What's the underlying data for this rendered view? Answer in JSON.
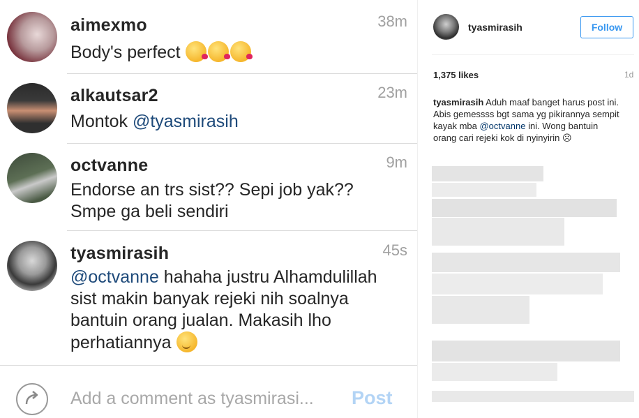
{
  "comments": [
    {
      "username": "aimexmo",
      "time": "38m",
      "text": "Body's perfect"
    },
    {
      "username": "alkautsar2",
      "time": "23m",
      "text_prefix": "Montok ",
      "mention": "@tyasmirasih"
    },
    {
      "username": "octvanne",
      "time": "9m",
      "line1": "Endorse an trs sist?? Sepi job yak??",
      "line2": "Smpe ga beli sendiri"
    },
    {
      "username": "tyasmirasih",
      "time": "45s",
      "mention": "@octvanne",
      "line1_rest": " hahaha justru Alhamdulillah",
      "line2": "sist makin banyak rejeki nih soalnya",
      "line3": "bantuin orang jualan. Makasih lho",
      "line4": "perhatiannya"
    }
  ],
  "composer": {
    "placeholder": "Add a comment as tyasmirasi...",
    "post_label": "Post"
  },
  "sidebar": {
    "username": "tyasmirasih",
    "follow_label": "Follow",
    "likes": "1,375 likes",
    "age": "1d",
    "caption_user": "tyasmirasih",
    "caption_text": " Aduh maaf banget harus post ini. Abis gemessss bgt sama yg pikirannya sempit kayak mba ",
    "caption_mention": "@octvanne",
    "caption_end": " ini. Wong bantuin orang cari rejeki kok di nyinyirin ☹"
  },
  "colors": {
    "mention": "#1e4a7a",
    "follow": "#3897f0",
    "post_disabled": "#b3d4f5"
  },
  "icons": {
    "share": "share-arrow-icon",
    "emoji_kiss": "kissing-heart-emoji",
    "emoji_wink": "winking-face-emoji"
  }
}
